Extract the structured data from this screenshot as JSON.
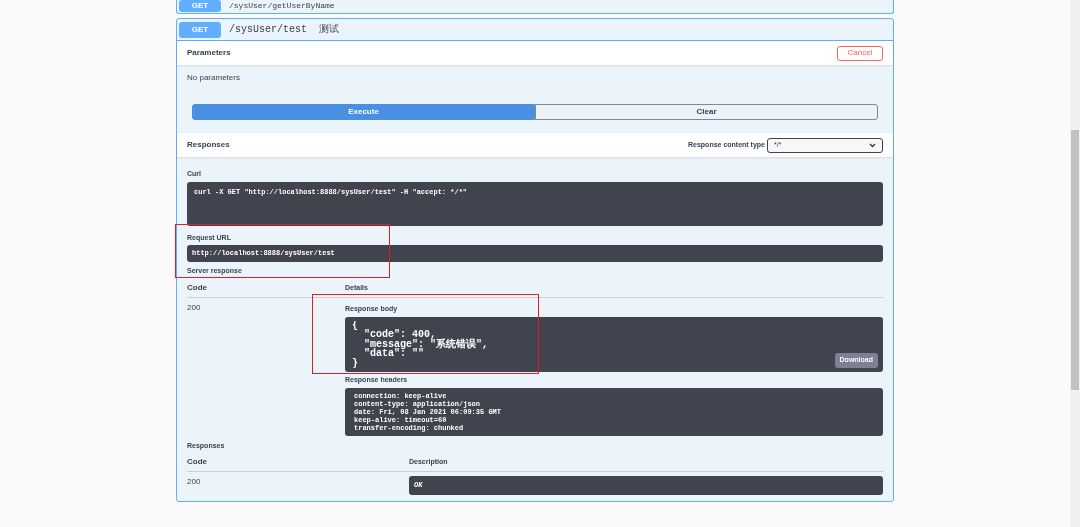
{
  "operations": [
    {
      "method": "GET",
      "path": "/sysUser/getUserByName",
      "expanded": false
    },
    {
      "method": "GET",
      "path": "/sysUser/test",
      "summary": "测试",
      "expanded": true
    }
  ],
  "parameters": {
    "title": "Parameters",
    "cancel_button": "Cancel",
    "message": "No parameters",
    "execute_button": "Execute",
    "clear_button": "Clear"
  },
  "responses_header": {
    "title": "Responses",
    "content_type_label": "Response content type",
    "content_type_value": "*/*"
  },
  "curl": {
    "label": "Curl",
    "command": "curl -X GET \"http://localhost:8888/sysUser/test\" -H \"accept: */*\""
  },
  "request_url": {
    "label": "Request URL",
    "value": "http://localhost:8888/sysUser/test"
  },
  "server_response": {
    "title": "Server response",
    "columns": [
      "Code",
      "Details"
    ],
    "code": "200",
    "body_label": "Response body",
    "body": "{\n  \"code\": 400,\n  \"message\": \"系统错误\",\n  \"data\": \"\"\n}",
    "download_button": "Download",
    "headers_label": "Response headers",
    "headers": "connection: keep-alive\ncontent-type: application/json\ndate: Fri, 08 Jan 2021 06:09:35 GMT\nkeep-alive: timeout=60\ntransfer-encoding: chunked"
  },
  "documented_responses": {
    "title": "Responses",
    "columns": [
      "Code",
      "Description"
    ],
    "rows": [
      {
        "code": "200",
        "description": "OK"
      }
    ]
  }
}
